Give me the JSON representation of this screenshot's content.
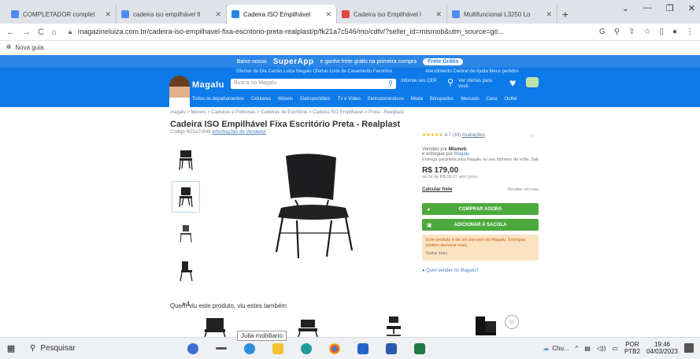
{
  "browser": {
    "tabs": [
      {
        "title": "COMPLETADOR complet",
        "color": "#4e8cf5",
        "active": false
      },
      {
        "title": "cadeira iso empilhável fi",
        "color": "#4e8cf5",
        "active": false
      },
      {
        "title": "Cadeira ISO Empilhável",
        "color": "#2b86e6",
        "active": true
      },
      {
        "title": "Cadeira iso Empilhável l",
        "color": "#e04545",
        "active": false
      },
      {
        "title": "Multifuncional L3250 Lo",
        "color": "#4e8cf5",
        "active": false
      }
    ],
    "url": "magazineluiza.com.br/cadeira-iso-empilhavel-fixa-escritorio-preta-realplast/p/fk21a7c546/mo/cdfv/?seller_id=mismob&utm_source=go...",
    "bookmark": "Nova guia"
  },
  "header": {
    "promo_text": "Baixe nosso",
    "promo_brand": "SuperApp",
    "promo_mid": "e ganhe frete grátis na primeira compra",
    "promo_button": "Frete Grátis",
    "sublinks": "Ofertas do Dia   Cartão Luiza   Magalu Ofertas   Lista de Casamento   Favoritos",
    "sublinks2": "Atendimento   Central de Ajuda   Meus pedidos",
    "logo": "Magalu",
    "search_placeholder": "Busca no Magalu",
    "location": "Informe seu CEP",
    "location_sub": "Ver ofertas para você",
    "menu": [
      "Todos os departamentos",
      "Celulares",
      "Móveis",
      "Eletroportáteis",
      "Tv e Vídeo",
      "Eletrodomésticos",
      "Moda",
      "Brinquedos",
      "Mercado",
      "Casa",
      "Outlet"
    ]
  },
  "product": {
    "breadcrumb": "magalu > Móveis > Cadeiras e Poltronas > Cadeiras de Escritório > Cadeira ISO Empilhável > Preta - Realplast",
    "title": "Cadeira ISO Empilhável Fixa Escritório Preta - Realplast",
    "code_prefix": "Código fk21a7c546",
    "code_link": "Informações do Vendedor",
    "more_images": "+4",
    "rating_count": "4.7 (19)",
    "rating_link": "Avaliações",
    "seller_label": "Vendido por",
    "seller_name": "Mismob",
    "seller_sub": "e entregue por",
    "seller_link": "Magalu",
    "delivery_note": "Entrega garantida pela Magalu ou seu dinheiro de volta. Saiba mais",
    "price": "R$ 179,00",
    "installments": "ou 3x de R$ 59,67 sem juros",
    "freight_label": "Calcular frete",
    "freight_note": "Receber em casa",
    "buy_button": "COMPRAR AGORA",
    "bag_button": "ADICIONAR À SACOLA",
    "notice": "Este produto é de um parceiro do Magalu. Entregas podem demorar mais.",
    "notice_link": "Saiba mais",
    "sell_link": "Quer vender no Magalu?",
    "see_also": "Quem viu este produto, viu estes também"
  },
  "taskbar": {
    "search": "Pesquisar",
    "tooltip": "Julia mobiliario",
    "weather": "Chu...",
    "lang": "POR",
    "lang_sub": "PTB2",
    "time": "19:46",
    "date": "04/03/2023"
  }
}
